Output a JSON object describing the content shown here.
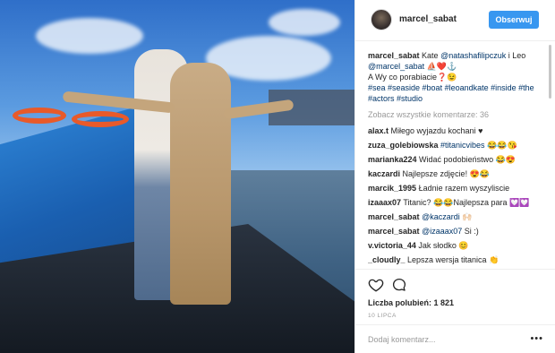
{
  "post": {
    "username": "marcel_sabat",
    "follow_label": "Obserwuj"
  },
  "caption": {
    "user": "marcel_sabat",
    "text_1": " Kate ",
    "mention_1": "@natashafilipczuk",
    "text_2": " i Leo ",
    "mention_2": "@marcel_sabat",
    "emoji_1": " ⛵❤️⚓",
    "line_2": "A Wy co porabiacie❓😉",
    "hashtags": "#sea #seaside #boat #leoandkate #inside #the #actors #studio"
  },
  "view_all": "Zobacz wszystkie komentarze: 36",
  "comments": [
    {
      "user": "alax.t",
      "text": " Miłego wyjazdu kochani ♥"
    },
    {
      "user": "zuza_golebiowska",
      "text": " #titanicvibes 😂😂😘"
    },
    {
      "user": "marianka224",
      "text": " Widać podobieństwo 😂😍"
    },
    {
      "user": "kaczardi",
      "text": " Najlepsze zdjęcie! 😍😂"
    },
    {
      "user": "marcik_1995",
      "text": " Ładnie razem wyszyliscie"
    },
    {
      "user": "izaaax07",
      "text": " Titanic? 😂😂Najlepsza para 💟💟"
    },
    {
      "user": "marcel_sabat",
      "mention": "@kaczardi",
      "text": " 🙌🏻"
    },
    {
      "user": "marcel_sabat",
      "mention": "@izaaax07",
      "text": " Si :)"
    },
    {
      "user": "v.victoria_44",
      "text": " Jak słodko 😊"
    },
    {
      "user": "_cloudly_",
      "text": " Lepsza wersja titanica 👏"
    }
  ],
  "actions": {
    "like_icon": "heart-icon",
    "comment_icon": "comment-icon"
  },
  "likes": "Liczba polubień: 1 821",
  "date": "10 LIPCA",
  "add_comment": {
    "placeholder": "Dodaj komentarz...",
    "more": "•••"
  }
}
